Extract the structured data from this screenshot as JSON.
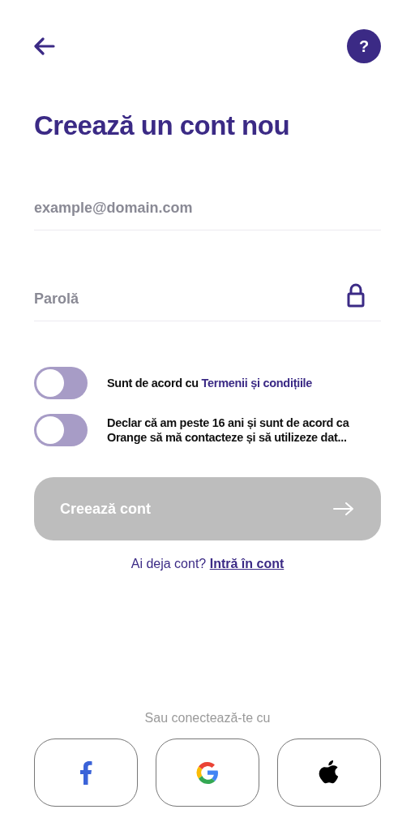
{
  "header": {
    "help": "?"
  },
  "title": "Creează un cont nou",
  "fields": [
    {
      "placeholder": "example@domain.com",
      "kind": "email"
    },
    {
      "placeholder": "Parolă",
      "kind": "password"
    }
  ],
  "consents": [
    {
      "on": false,
      "text": "Sunt de acord cu ",
      "link": "Termenii și condițiile"
    },
    {
      "on": false,
      "text": "Declar că am peste 16 ani și sunt de acord ca Orange să mă contacteze și să utilizeze dat..."
    }
  ],
  "submit": {
    "label": "Creează cont",
    "disabled": true
  },
  "login": {
    "text": "Ai deja cont?",
    "link": "Intră în cont"
  },
  "social": {
    "label": "Sau conectează-te cu",
    "buttons": [
      {
        "kind": "facebook"
      },
      {
        "kind": "google"
      },
      {
        "kind": "apple"
      }
    ]
  }
}
